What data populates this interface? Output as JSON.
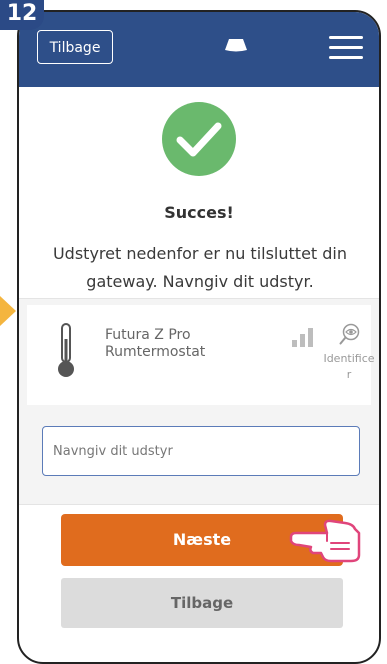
{
  "step": {
    "number": "12"
  },
  "header": {
    "back_label": "Tilbage",
    "logo_icon": "salus-logo-icon",
    "menu_icon": "hamburger-menu-icon"
  },
  "status": {
    "icon": "success-check-icon",
    "title": "Succes!",
    "description": "Udstyret nedenfor er nu tilsluttet din gateway. Navngiv dit udstyr."
  },
  "device": {
    "name": "Futura Z Pro",
    "type": "Rumtermostat",
    "icon": "thermometer-icon",
    "signal_icon": "signal-strength-icon",
    "identify_icon": "identify-icon",
    "identify_label": "Identificer"
  },
  "name_field": {
    "placeholder": "Navngiv dit udstyr",
    "value": ""
  },
  "actions": {
    "next_label": "Næste",
    "back_label": "Tilbage"
  },
  "colors": {
    "header": "#2e4f89",
    "success": "#6ab96d",
    "primary_button": "#e06c1e",
    "secondary_button": "#dcdcdc",
    "badge": "#2b4a86",
    "pointer_arrow": "#f4b53f"
  }
}
